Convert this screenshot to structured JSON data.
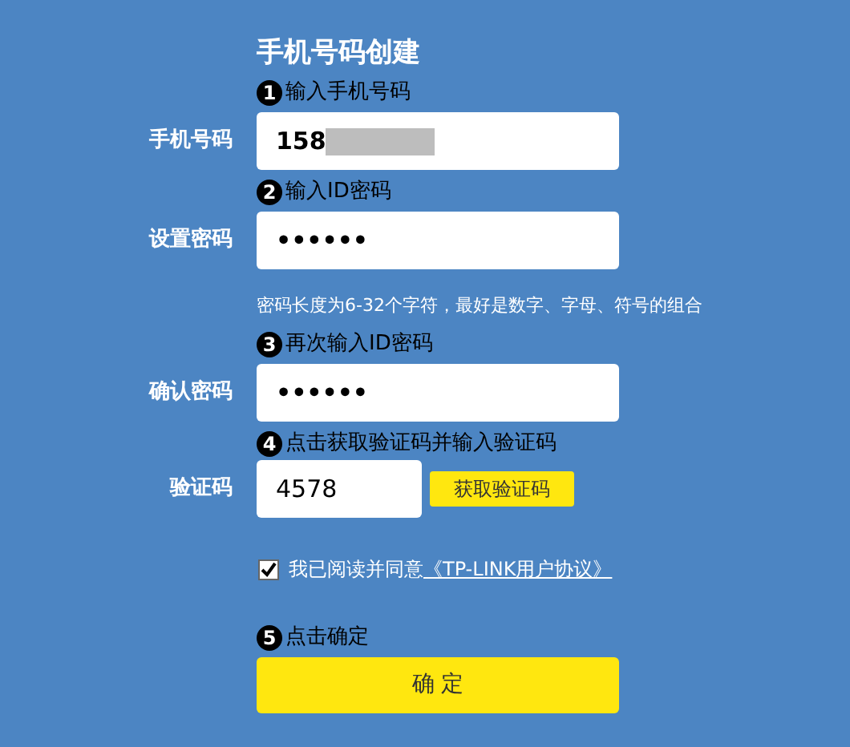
{
  "title": "手机号码创建",
  "rows": [
    {
      "kind": "step",
      "number": "1",
      "text": "输入手机号码"
    },
    {
      "kind": "field",
      "label": "手机号码",
      "value": "158",
      "redacted": true
    },
    {
      "kind": "step",
      "number": "2",
      "text": "输入ID密码"
    },
    {
      "kind": "field",
      "label": "设置密码",
      "value": "••••••",
      "redacted": false
    },
    {
      "kind": "hint",
      "text": "密码长度为6-32个字符，最好是数字、字母、符号的组合"
    },
    {
      "kind": "step",
      "number": "3",
      "text": "再次输入ID密码"
    },
    {
      "kind": "field",
      "label": "确认密码",
      "value": "••••••",
      "redacted": false
    },
    {
      "kind": "step",
      "number": "4",
      "text": "点击获取验证码并输入验证码"
    },
    {
      "kind": "code",
      "label": "验证码",
      "value": "4578",
      "button": "获取验证码"
    },
    {
      "kind": "agreement",
      "checked": true,
      "text": "我已阅读并同意",
      "link": "《TP-LINK用户协议》"
    },
    {
      "kind": "step",
      "number": "5",
      "text": "点击确定"
    },
    {
      "kind": "submit",
      "text": "确 定"
    }
  ]
}
